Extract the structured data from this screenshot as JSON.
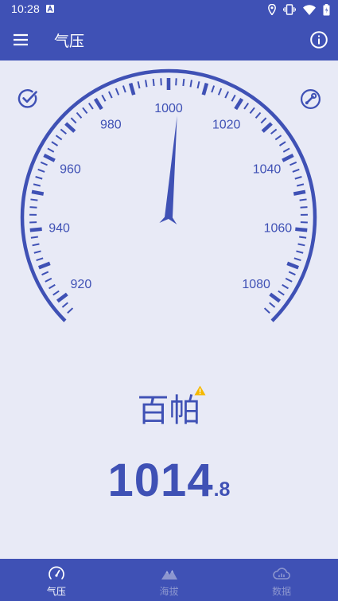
{
  "status_bar": {
    "time": "10:28",
    "icons": [
      "notification-a-icon",
      "location-icon",
      "vibrate-icon",
      "wifi-icon",
      "battery-icon"
    ]
  },
  "app_bar": {
    "title": "气压",
    "menu_icon": "menu-icon",
    "info_icon": "info-icon"
  },
  "colors": {
    "primary": "#3f51b5",
    "background": "#e8eaf6",
    "inactive_nav": "#8c96cf",
    "warning": "#f5b800"
  },
  "gauge": {
    "min": 915,
    "max": 1085,
    "value": 1014.8,
    "needle_reading": 1003,
    "major_labels": [
      "920",
      "940",
      "960",
      "980",
      "1000",
      "1020",
      "1040",
      "1060",
      "1080"
    ],
    "calibrate_icon": "check-circle-icon",
    "settings_icon": "wrench-circle-icon"
  },
  "unit": {
    "label": "百帕",
    "warning_icon": "warning-icon"
  },
  "reading": {
    "main": "1014",
    "decimal": ".8"
  },
  "bottom_nav": [
    {
      "label": "气压",
      "icon": "gauge-icon",
      "active": true
    },
    {
      "label": "海拔",
      "icon": "mountain-icon",
      "active": false
    },
    {
      "label": "数据",
      "icon": "cloud-chart-icon",
      "active": false
    }
  ]
}
